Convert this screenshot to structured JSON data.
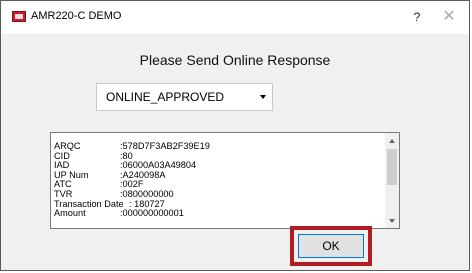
{
  "window": {
    "title": "AMR220-C DEMO",
    "help_label": "?",
    "close_label": "✕"
  },
  "prompt": "Please Send Online Response",
  "response_select": {
    "selected": "ONLINE_APPROVED"
  },
  "details": [
    {
      "key": "ARQC",
      "value": ":578D7F3AB2F39E19"
    },
    {
      "key": "CID",
      "value": ":80"
    },
    {
      "key": "IAD",
      "value": ":06000A03A49804"
    },
    {
      "key": "UP Num",
      "value": ":A240098A"
    },
    {
      "key": "ATC",
      "value": ":002F"
    },
    {
      "key": "TVR",
      "value": ":0800000000"
    },
    {
      "key": "Transaction Date",
      "value": ": 180727"
    },
    {
      "key": "Amount",
      "value": ":000000000001"
    }
  ],
  "ok_label": "OK",
  "colors": {
    "highlight": "#b01c22",
    "app_icon": "#c41f2c",
    "button_border": "#0078d7"
  }
}
